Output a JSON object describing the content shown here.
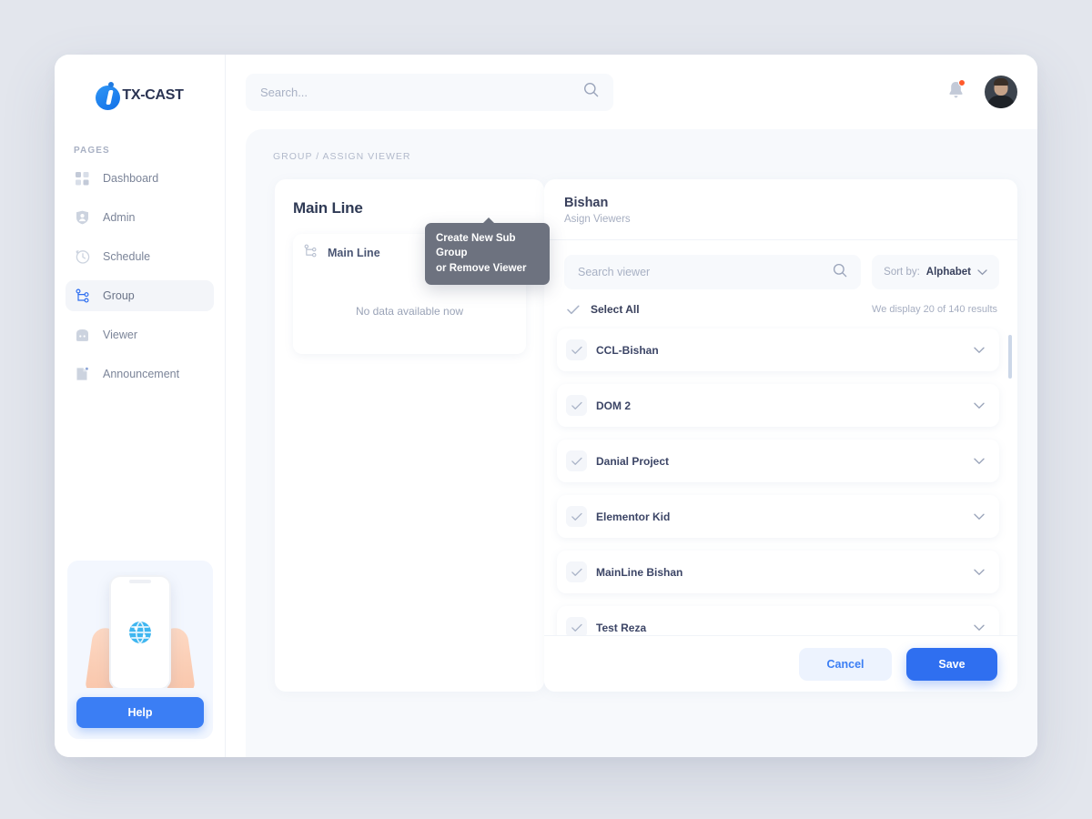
{
  "brand": {
    "logo_icon": "itx-cast-logo-icon",
    "name": "TX-CAST"
  },
  "sidebar": {
    "section_label": "PAGES",
    "items": [
      {
        "label": "Dashboard",
        "icon": "grid-icon",
        "active": false
      },
      {
        "label": "Admin",
        "icon": "user-shield-icon",
        "active": false
      },
      {
        "label": "Schedule",
        "icon": "clock-icon",
        "active": false
      },
      {
        "label": "Group",
        "icon": "hierarchy-icon",
        "active": true
      },
      {
        "label": "Viewer",
        "icon": "monitor-icon",
        "active": false
      },
      {
        "label": "Announcement",
        "icon": "document-icon",
        "active": false
      }
    ],
    "help_card": {
      "illustration": "hand-holding-phone-illustration",
      "button_label": "Help"
    }
  },
  "topbar": {
    "search": {
      "placeholder": "Search...",
      "value": "",
      "icon": "search-icon"
    },
    "notifications": {
      "icon": "bell-icon",
      "has_unread": true,
      "badge_color": "#ff5a2b"
    },
    "avatar": {
      "icon": "avatar"
    }
  },
  "content": {
    "breadcrumb": "GROUP / ASSIGN VIEWER"
  },
  "left_panel": {
    "title": "Main Line",
    "tree": {
      "root_label": "Main Line",
      "root_icon": "hierarchy-icon",
      "more_button_icon": "more-dots-icon",
      "empty_text": "No data available now"
    },
    "tooltip": {
      "line1": "Create New Sub Group",
      "line2": "or Remove Viewer"
    }
  },
  "right_panel": {
    "title": "Bishan",
    "subtitle": "Asign Viewers",
    "search": {
      "placeholder": "Search viewer",
      "value": "",
      "icon": "search-icon"
    },
    "sort": {
      "label": "Sort by:",
      "value": "Alphabet",
      "icon": "chevron-down-icon"
    },
    "select_all": {
      "label": "Select All",
      "icon": "check-icon",
      "results_text": "We display 20 of 140 results"
    },
    "viewers": [
      {
        "label": "CCL-Bishan",
        "checked": true
      },
      {
        "label": "DOM 2",
        "checked": true
      },
      {
        "label": "Danial Project",
        "checked": true
      },
      {
        "label": "Elementor Kid",
        "checked": true
      },
      {
        "label": "MainLine Bishan",
        "checked": true
      },
      {
        "label": "Test Reza",
        "checked": true
      }
    ],
    "footer": {
      "cancel_label": "Cancel",
      "save_label": "Save"
    }
  },
  "colors": {
    "accent": "#2f6ff0",
    "accent_soft": "#edf3fe",
    "page_bg": "#e3e6ed",
    "content_bg": "#f7f9fc",
    "text_dark": "#39405c",
    "text_muted": "#a6aec1",
    "tooltip_bg": "#6d727f",
    "badge": "#ff5a2b"
  }
}
